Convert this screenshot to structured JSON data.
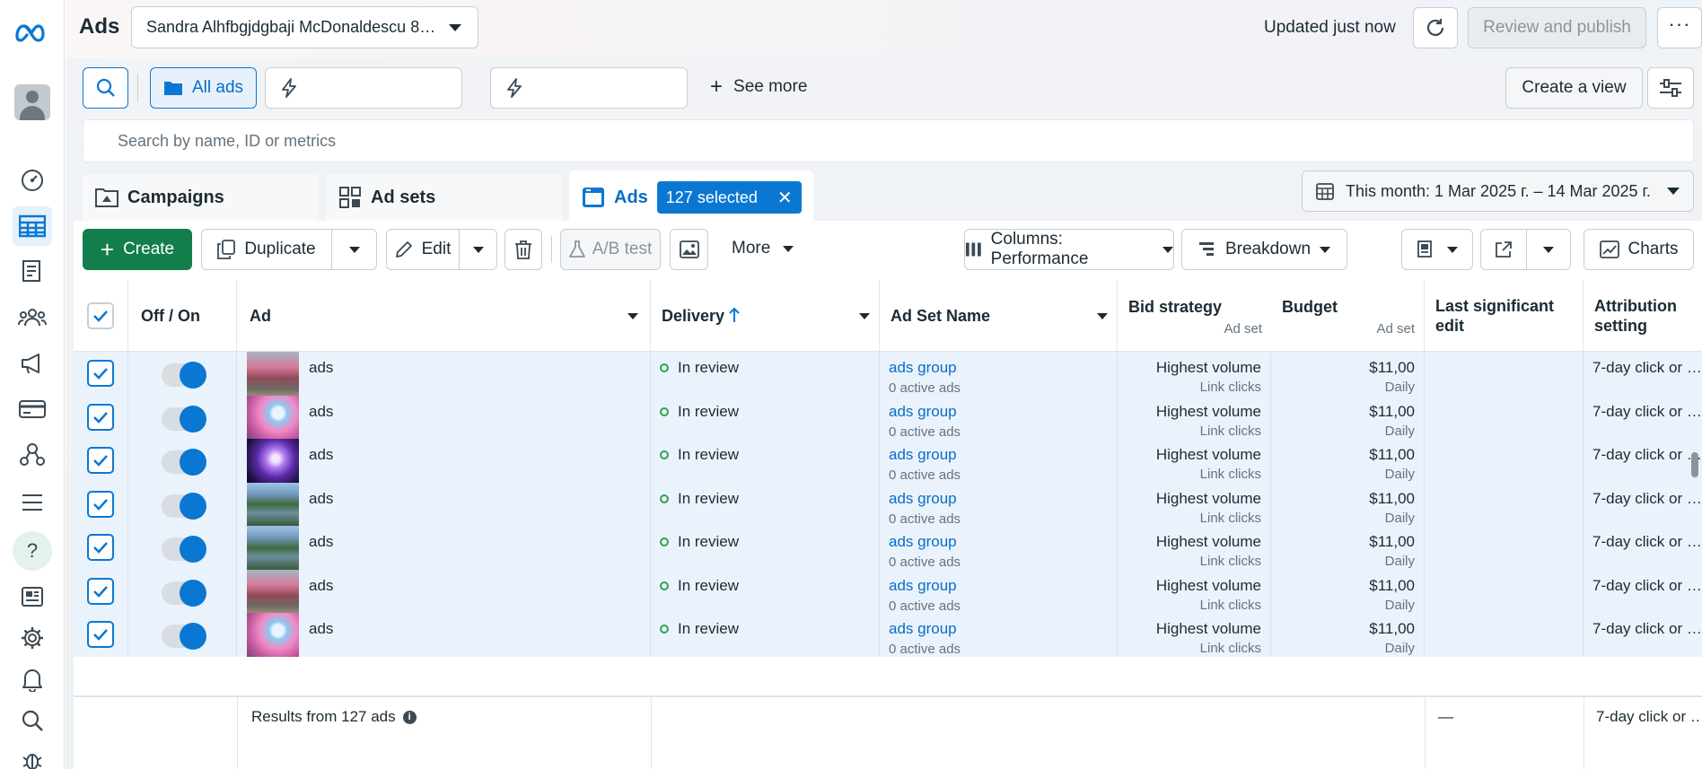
{
  "app": {
    "title": "Ads",
    "account": "Sandra Alhfbgjdgbaji McDonaldescu 8…"
  },
  "topbar": {
    "updated": "Updated just now",
    "review_label": "Review and publish"
  },
  "filters": {
    "all_ads_label": "All ads",
    "see_more_label": "See more",
    "create_view_label": "Create a view"
  },
  "search": {
    "placeholder": "Search by name, ID or metrics"
  },
  "tabs": {
    "campaigns": "Campaigns",
    "adsets": "Ad sets",
    "ads": "Ads",
    "selected_badge": "127 selected"
  },
  "date_range": "This month: 1 Mar 2025 г. – 14 Mar 2025 г.",
  "toolbar": {
    "create": "Create",
    "duplicate": "Duplicate",
    "edit": "Edit",
    "ab_test": "A/B test",
    "more": "More",
    "columns": "Columns: Performance",
    "breakdown": "Breakdown",
    "charts": "Charts"
  },
  "columns": {
    "off_on": "Off / On",
    "ad": "Ad",
    "delivery": "Delivery",
    "adset_name": "Ad Set Name",
    "bid_strategy": "Bid strategy",
    "bid_strategy_sub": "Ad set",
    "budget": "Budget",
    "budget_sub": "Ad set",
    "last_edit": "Last significant edit",
    "attribution": "Attribution setting"
  },
  "rows": [
    {
      "name": "ads",
      "delivery": "In review",
      "adset": "ads group",
      "adset_sub": "0 active ads",
      "bid": "Highest volume",
      "bid_sub": "Link clicks",
      "budget": "$11,00",
      "budget_sub": "Daily",
      "attribution": "7-day click or …",
      "thumb": "pink-trees"
    },
    {
      "name": "ads",
      "delivery": "In review",
      "adset": "ads group",
      "adset_sub": "0 active ads",
      "bid": "Highest volume",
      "bid_sub": "Link clicks",
      "budget": "$11,00",
      "budget_sub": "Daily",
      "attribution": "7-day click or …",
      "thumb": "pink-blossom"
    },
    {
      "name": "ads",
      "delivery": "In review",
      "adset": "ads group",
      "adset_sub": "0 active ads",
      "bid": "Highest volume",
      "bid_sub": "Link clicks",
      "budget": "$11,00",
      "budget_sub": "Daily",
      "attribution": "7-day click or …",
      "thumb": "purple-galaxy"
    },
    {
      "name": "ads",
      "delivery": "In review",
      "adset": "ads group",
      "adset_sub": "0 active ads",
      "bid": "Highest volume",
      "bid_sub": "Link clicks",
      "budget": "$11,00",
      "budget_sub": "Daily",
      "attribution": "7-day click or …",
      "thumb": "mountain-lake"
    },
    {
      "name": "ads",
      "delivery": "In review",
      "adset": "ads group",
      "adset_sub": "0 active ads",
      "bid": "Highest volume",
      "bid_sub": "Link clicks",
      "budget": "$11,00",
      "budget_sub": "Daily",
      "attribution": "7-day click or …",
      "thumb": "mountain-lake"
    },
    {
      "name": "ads",
      "delivery": "In review",
      "adset": "ads group",
      "adset_sub": "0 active ads",
      "bid": "Highest volume",
      "bid_sub": "Link clicks",
      "budget": "$11,00",
      "budget_sub": "Daily",
      "attribution": "7-day click or …",
      "thumb": "pink-trees"
    },
    {
      "name": "ads",
      "delivery": "In review",
      "adset": "ads group",
      "adset_sub": "0 active ads",
      "bid": "Highest volume",
      "bid_sub": "Link clicks",
      "budget": "$11,00",
      "budget_sub": "Daily",
      "attribution": "7-day click or …",
      "thumb": "pink-blossom"
    }
  ],
  "footer": {
    "results": "Results from 127 ads",
    "last_edit": "—",
    "attribution": "7-day click or …"
  },
  "colors": {
    "accent": "#0a78d2",
    "create_green": "#127e4c",
    "status_green": "#31a24c",
    "selected_row": "#eaf3fc"
  },
  "icons": [
    "meta-logo",
    "avatar",
    "dashboard-icon",
    "table-icon",
    "pages-icon",
    "audience-icon",
    "megaphone-icon",
    "billing-icon",
    "events-icon",
    "menu-icon",
    "help-icon",
    "news-icon",
    "settings-icon",
    "bell-icon",
    "search-icon",
    "bug-icon",
    "refresh-icon",
    "more-icon",
    "folder-icon",
    "lightning-icon",
    "plus-icon",
    "sliders-icon",
    "campaign-icon",
    "adsets-icon",
    "ad-icon",
    "calendar-icon",
    "duplicate-icon",
    "pencil-icon",
    "trash-icon",
    "flask-icon",
    "image-icon",
    "columns-icon",
    "breakdown-icon",
    "report-icon",
    "export-icon",
    "chart-icon",
    "info-icon",
    "sort-up-icon"
  ]
}
